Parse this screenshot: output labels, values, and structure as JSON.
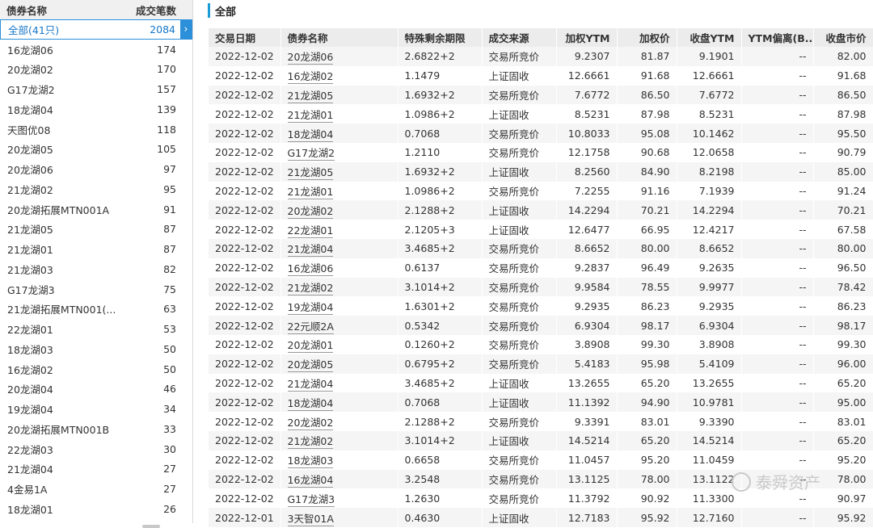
{
  "left_panel": {
    "header": {
      "name": "债券名称",
      "count": "成交笔数"
    },
    "selected": {
      "name": "全部(41只)",
      "count": "2084"
    },
    "items": [
      {
        "name": "16龙湖06",
        "count": "174"
      },
      {
        "name": "20龙湖02",
        "count": "170"
      },
      {
        "name": "G17龙湖2",
        "count": "157"
      },
      {
        "name": "18龙湖04",
        "count": "139"
      },
      {
        "name": "天图优08",
        "count": "118"
      },
      {
        "name": "20龙湖05",
        "count": "105"
      },
      {
        "name": "20龙湖06",
        "count": "97"
      },
      {
        "name": "21龙湖02",
        "count": "95"
      },
      {
        "name": "20龙湖拓展MTN001A",
        "count": "91"
      },
      {
        "name": "21龙湖05",
        "count": "87"
      },
      {
        "name": "21龙湖01",
        "count": "87"
      },
      {
        "name": "21龙湖03",
        "count": "82"
      },
      {
        "name": "G17龙湖3",
        "count": "75"
      },
      {
        "name": "21龙湖拓展MTN001(...",
        "count": "63"
      },
      {
        "name": "22龙湖01",
        "count": "53"
      },
      {
        "name": "18龙湖03",
        "count": "50"
      },
      {
        "name": "16龙湖02",
        "count": "50"
      },
      {
        "name": "20龙湖04",
        "count": "46"
      },
      {
        "name": "19龙湖04",
        "count": "34"
      },
      {
        "name": "20龙湖拓展MTN001B",
        "count": "33"
      },
      {
        "name": "22龙湖03",
        "count": "30"
      },
      {
        "name": "21龙湖04",
        "count": "27"
      },
      {
        "name": "4金易1A",
        "count": "27"
      },
      {
        "name": "18龙湖01",
        "count": "26"
      }
    ]
  },
  "main": {
    "title": "全部",
    "columns": [
      "交易日期",
      "债券名称",
      "特殊剩余期限",
      "成交来源",
      "加权YTM",
      "加权价",
      "收盘YTM",
      "YTM偏离(B...",
      "收盘市价"
    ],
    "rows": [
      [
        "2022-12-02",
        "20龙湖06",
        "2.6822+2",
        "交易所竞价",
        "9.2307",
        "81.87",
        "9.1901",
        "--",
        "82.00"
      ],
      [
        "2022-12-02",
        "16龙湖02",
        "1.1479",
        "上证固收",
        "12.6661",
        "91.68",
        "12.6661",
        "--",
        "91.68"
      ],
      [
        "2022-12-02",
        "21龙湖05",
        "1.6932+2",
        "交易所竞价",
        "7.6772",
        "86.50",
        "7.6772",
        "--",
        "86.50"
      ],
      [
        "2022-12-02",
        "21龙湖01",
        "1.0986+2",
        "上证固收",
        "8.5231",
        "87.98",
        "8.5231",
        "--",
        "87.98"
      ],
      [
        "2022-12-02",
        "18龙湖04",
        "0.7068",
        "交易所竞价",
        "10.8033",
        "95.08",
        "10.1462",
        "--",
        "95.50"
      ],
      [
        "2022-12-02",
        "G17龙湖2",
        "1.2110",
        "交易所竞价",
        "12.1758",
        "90.68",
        "12.0658",
        "--",
        "90.79"
      ],
      [
        "2022-12-02",
        "21龙湖05",
        "1.6932+2",
        "上证固收",
        "8.2560",
        "84.90",
        "8.2198",
        "--",
        "85.00"
      ],
      [
        "2022-12-02",
        "21龙湖01",
        "1.0986+2",
        "交易所竞价",
        "7.2255",
        "91.16",
        "7.1939",
        "--",
        "91.24"
      ],
      [
        "2022-12-02",
        "20龙湖02",
        "2.1288+2",
        "上证固收",
        "14.2294",
        "70.21",
        "14.2294",
        "--",
        "70.21"
      ],
      [
        "2022-12-02",
        "22龙湖01",
        "2.1205+3",
        "上证固收",
        "12.6477",
        "66.95",
        "12.4217",
        "--",
        "67.58"
      ],
      [
        "2022-12-02",
        "21龙湖04",
        "3.4685+2",
        "交易所竞价",
        "8.6652",
        "80.00",
        "8.6652",
        "--",
        "80.00"
      ],
      [
        "2022-12-02",
        "16龙湖06",
        "0.6137",
        "交易所竞价",
        "9.2837",
        "96.49",
        "9.2635",
        "--",
        "96.50"
      ],
      [
        "2022-12-02",
        "21龙湖02",
        "3.1014+2",
        "交易所竞价",
        "9.9584",
        "78.55",
        "9.9977",
        "--",
        "78.42"
      ],
      [
        "2022-12-02",
        "19龙湖04",
        "1.6301+2",
        "交易所竞价",
        "9.2935",
        "86.23",
        "9.2935",
        "--",
        "86.23"
      ],
      [
        "2022-12-02",
        "22元顺2A",
        "0.5342",
        "交易所竞价",
        "6.9304",
        "98.17",
        "6.9304",
        "--",
        "98.17"
      ],
      [
        "2022-12-02",
        "20龙湖01",
        "0.1260+2",
        "交易所竞价",
        "3.8908",
        "99.30",
        "3.8908",
        "--",
        "99.30"
      ],
      [
        "2022-12-02",
        "20龙湖05",
        "0.6795+2",
        "交易所竞价",
        "5.4183",
        "95.98",
        "5.4109",
        "--",
        "96.00"
      ],
      [
        "2022-12-02",
        "21龙湖04",
        "3.4685+2",
        "上证固收",
        "13.2655",
        "65.20",
        "13.2655",
        "--",
        "65.20"
      ],
      [
        "2022-12-02",
        "18龙湖04",
        "0.7068",
        "上证固收",
        "11.1392",
        "94.90",
        "10.9781",
        "--",
        "95.00"
      ],
      [
        "2022-12-02",
        "20龙湖02",
        "2.1288+2",
        "交易所竞价",
        "9.3391",
        "83.01",
        "9.3390",
        "--",
        "83.01"
      ],
      [
        "2022-12-02",
        "21龙湖02",
        "3.1014+2",
        "上证固收",
        "14.5214",
        "65.20",
        "14.5214",
        "--",
        "65.20"
      ],
      [
        "2022-12-02",
        "18龙湖03",
        "0.6658",
        "交易所竞价",
        "11.0457",
        "95.20",
        "11.0459",
        "--",
        "95.20"
      ],
      [
        "2022-12-02",
        "16龙湖04",
        "3.2548",
        "交易所竞价",
        "13.1125",
        "78.00",
        "13.1122",
        "--",
        "78.00"
      ],
      [
        "2022-12-02",
        "G17龙湖3",
        "1.2630",
        "交易所竞价",
        "11.3792",
        "90.92",
        "11.3300",
        "--",
        "90.97"
      ],
      [
        "2022-12-01",
        "3天智01A",
        "0.4630",
        "上证固收",
        "12.7183",
        "95.92",
        "12.7160",
        "--",
        "95.92"
      ]
    ]
  },
  "watermark": {
    "text": "泰舜资产",
    "overlay": "wind"
  },
  "colors": {
    "accent": "#2b8fd9",
    "title_bar": "#1b9bd5",
    "header_bg": "#ececec"
  }
}
